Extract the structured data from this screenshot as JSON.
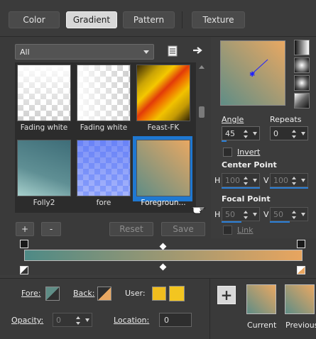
{
  "tabs": [
    {
      "label": "Color",
      "active": false
    },
    {
      "label": "Gradient",
      "active": true
    },
    {
      "label": "Pattern",
      "active": false
    },
    {
      "label": "Texture",
      "active": false
    }
  ],
  "library": {
    "category": "All",
    "thumbnails": [
      {
        "label": "Fading white",
        "kind": "checker-fade"
      },
      {
        "label": "Fading white",
        "kind": "checker-fade"
      },
      {
        "label": "Feast-FK",
        "kind": "stripe"
      },
      {
        "label": "Folly2",
        "kind": "teal"
      },
      {
        "label": "fore",
        "kind": "checker-blue"
      },
      {
        "label": "Foregroun...",
        "kind": "foreground",
        "selected": true
      }
    ],
    "buttons": {
      "add": "+",
      "remove": "-",
      "reset": "Reset",
      "save": "Save"
    }
  },
  "gradient": {
    "start_color": "#4e8a86",
    "end_color": "#e8a55f"
  },
  "properties": {
    "angle_label": "Angle",
    "angle": "45",
    "repeats_label": "Repeats",
    "repeats": "0",
    "invert_label": "Invert",
    "center_label": "Center Point",
    "center_h_label": "H",
    "center_h": "100",
    "center_v_label": "V",
    "center_v": "100",
    "focal_label": "Focal Point",
    "focal_h_label": "H",
    "focal_h": "50",
    "focal_v_label": "V",
    "focal_v": "50",
    "link_label": "Link"
  },
  "bottom": {
    "fore_label": "Fore:",
    "back_label": "Back:",
    "user_label": "User:",
    "user_color_1": "#f0bd1e",
    "user_color_2": "#f3c520",
    "opacity_label": "Opacity:",
    "opacity": "0",
    "location_label": "Location:",
    "location": "0",
    "current_label": "Current",
    "previous_label": "Previous"
  },
  "colors": {
    "accent": "#1f78d1",
    "panel_bg": "#3a3a3a"
  }
}
